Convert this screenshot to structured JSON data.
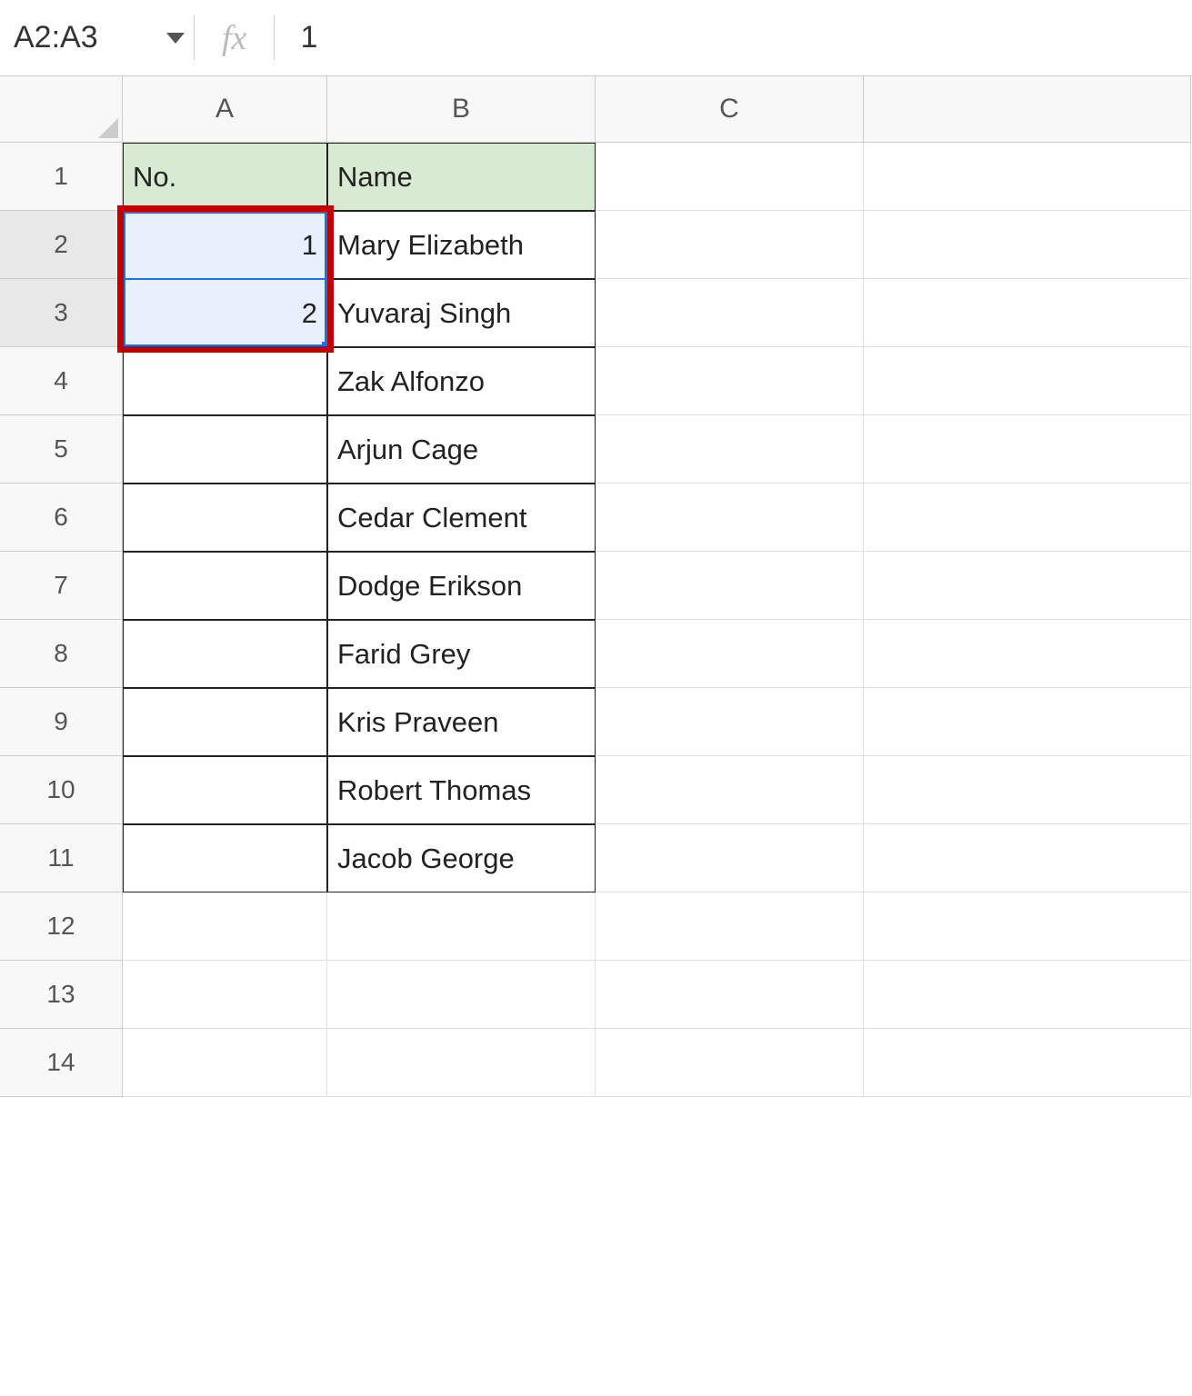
{
  "name_box": "A2:A3",
  "fx_label": "fx",
  "formula_value": "1",
  "columns": [
    "A",
    "B",
    "C",
    ""
  ],
  "rows": [
    "1",
    "2",
    "3",
    "4",
    "5",
    "6",
    "7",
    "8",
    "9",
    "10",
    "11",
    "12",
    "13",
    "14"
  ],
  "selected_rows": [
    "2",
    "3"
  ],
  "headers": {
    "no": "No.",
    "name": "Name"
  },
  "data": [
    {
      "no": "1",
      "name": "Mary Elizabeth"
    },
    {
      "no": "2",
      "name": "Yuvaraj Singh"
    },
    {
      "no": "",
      "name": "Zak Alfonzo"
    },
    {
      "no": "",
      "name": "Arjun Cage"
    },
    {
      "no": "",
      "name": "Cedar Clement"
    },
    {
      "no": "",
      "name": "Dodge Erikson"
    },
    {
      "no": "",
      "name": "Farid Grey"
    },
    {
      "no": "",
      "name": "Kris Praveen"
    },
    {
      "no": "",
      "name": "Robert Thomas"
    },
    {
      "no": "",
      "name": "Jacob George"
    }
  ]
}
